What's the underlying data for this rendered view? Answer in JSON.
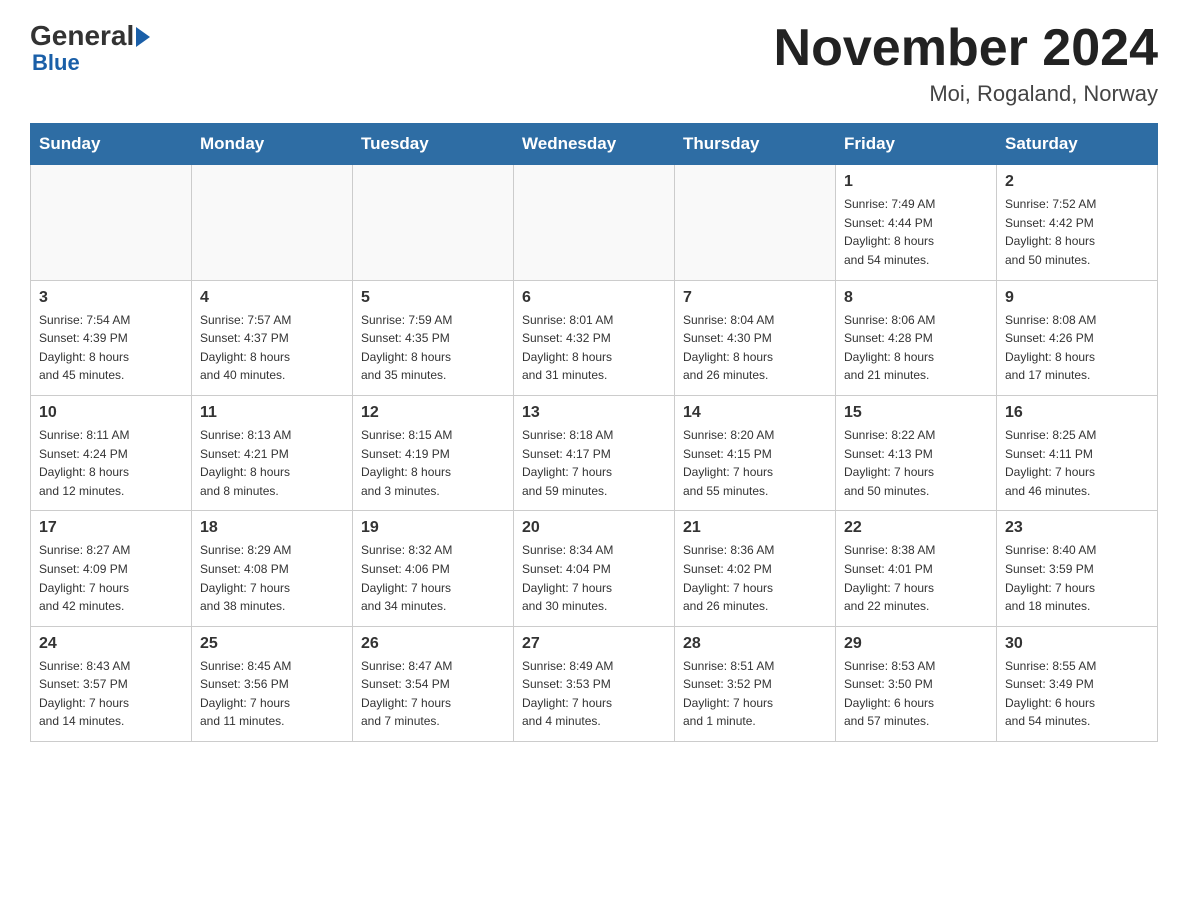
{
  "header": {
    "logo_general": "General",
    "logo_blue": "Blue",
    "title": "November 2024",
    "subtitle": "Moi, Rogaland, Norway"
  },
  "weekdays": [
    "Sunday",
    "Monday",
    "Tuesday",
    "Wednesday",
    "Thursday",
    "Friday",
    "Saturday"
  ],
  "weeks": [
    [
      {
        "day": "",
        "info": ""
      },
      {
        "day": "",
        "info": ""
      },
      {
        "day": "",
        "info": ""
      },
      {
        "day": "",
        "info": ""
      },
      {
        "day": "",
        "info": ""
      },
      {
        "day": "1",
        "info": "Sunrise: 7:49 AM\nSunset: 4:44 PM\nDaylight: 8 hours\nand 54 minutes."
      },
      {
        "day": "2",
        "info": "Sunrise: 7:52 AM\nSunset: 4:42 PM\nDaylight: 8 hours\nand 50 minutes."
      }
    ],
    [
      {
        "day": "3",
        "info": "Sunrise: 7:54 AM\nSunset: 4:39 PM\nDaylight: 8 hours\nand 45 minutes."
      },
      {
        "day": "4",
        "info": "Sunrise: 7:57 AM\nSunset: 4:37 PM\nDaylight: 8 hours\nand 40 minutes."
      },
      {
        "day": "5",
        "info": "Sunrise: 7:59 AM\nSunset: 4:35 PM\nDaylight: 8 hours\nand 35 minutes."
      },
      {
        "day": "6",
        "info": "Sunrise: 8:01 AM\nSunset: 4:32 PM\nDaylight: 8 hours\nand 31 minutes."
      },
      {
        "day": "7",
        "info": "Sunrise: 8:04 AM\nSunset: 4:30 PM\nDaylight: 8 hours\nand 26 minutes."
      },
      {
        "day": "8",
        "info": "Sunrise: 8:06 AM\nSunset: 4:28 PM\nDaylight: 8 hours\nand 21 minutes."
      },
      {
        "day": "9",
        "info": "Sunrise: 8:08 AM\nSunset: 4:26 PM\nDaylight: 8 hours\nand 17 minutes."
      }
    ],
    [
      {
        "day": "10",
        "info": "Sunrise: 8:11 AM\nSunset: 4:24 PM\nDaylight: 8 hours\nand 12 minutes."
      },
      {
        "day": "11",
        "info": "Sunrise: 8:13 AM\nSunset: 4:21 PM\nDaylight: 8 hours\nand 8 minutes."
      },
      {
        "day": "12",
        "info": "Sunrise: 8:15 AM\nSunset: 4:19 PM\nDaylight: 8 hours\nand 3 minutes."
      },
      {
        "day": "13",
        "info": "Sunrise: 8:18 AM\nSunset: 4:17 PM\nDaylight: 7 hours\nand 59 minutes."
      },
      {
        "day": "14",
        "info": "Sunrise: 8:20 AM\nSunset: 4:15 PM\nDaylight: 7 hours\nand 55 minutes."
      },
      {
        "day": "15",
        "info": "Sunrise: 8:22 AM\nSunset: 4:13 PM\nDaylight: 7 hours\nand 50 minutes."
      },
      {
        "day": "16",
        "info": "Sunrise: 8:25 AM\nSunset: 4:11 PM\nDaylight: 7 hours\nand 46 minutes."
      }
    ],
    [
      {
        "day": "17",
        "info": "Sunrise: 8:27 AM\nSunset: 4:09 PM\nDaylight: 7 hours\nand 42 minutes."
      },
      {
        "day": "18",
        "info": "Sunrise: 8:29 AM\nSunset: 4:08 PM\nDaylight: 7 hours\nand 38 minutes."
      },
      {
        "day": "19",
        "info": "Sunrise: 8:32 AM\nSunset: 4:06 PM\nDaylight: 7 hours\nand 34 minutes."
      },
      {
        "day": "20",
        "info": "Sunrise: 8:34 AM\nSunset: 4:04 PM\nDaylight: 7 hours\nand 30 minutes."
      },
      {
        "day": "21",
        "info": "Sunrise: 8:36 AM\nSunset: 4:02 PM\nDaylight: 7 hours\nand 26 minutes."
      },
      {
        "day": "22",
        "info": "Sunrise: 8:38 AM\nSunset: 4:01 PM\nDaylight: 7 hours\nand 22 minutes."
      },
      {
        "day": "23",
        "info": "Sunrise: 8:40 AM\nSunset: 3:59 PM\nDaylight: 7 hours\nand 18 minutes."
      }
    ],
    [
      {
        "day": "24",
        "info": "Sunrise: 8:43 AM\nSunset: 3:57 PM\nDaylight: 7 hours\nand 14 minutes."
      },
      {
        "day": "25",
        "info": "Sunrise: 8:45 AM\nSunset: 3:56 PM\nDaylight: 7 hours\nand 11 minutes."
      },
      {
        "day": "26",
        "info": "Sunrise: 8:47 AM\nSunset: 3:54 PM\nDaylight: 7 hours\nand 7 minutes."
      },
      {
        "day": "27",
        "info": "Sunrise: 8:49 AM\nSunset: 3:53 PM\nDaylight: 7 hours\nand 4 minutes."
      },
      {
        "day": "28",
        "info": "Sunrise: 8:51 AM\nSunset: 3:52 PM\nDaylight: 7 hours\nand 1 minute."
      },
      {
        "day": "29",
        "info": "Sunrise: 8:53 AM\nSunset: 3:50 PM\nDaylight: 6 hours\nand 57 minutes."
      },
      {
        "day": "30",
        "info": "Sunrise: 8:55 AM\nSunset: 3:49 PM\nDaylight: 6 hours\nand 54 minutes."
      }
    ]
  ]
}
